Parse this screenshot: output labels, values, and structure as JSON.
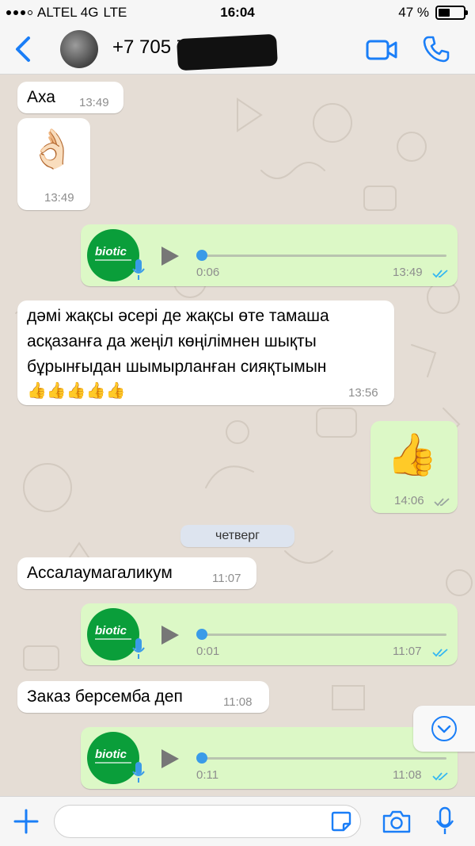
{
  "status_bar": {
    "carrier": "ALTEL 4G",
    "network": "LTE",
    "time": "16:04",
    "battery": "47 %",
    "battery_level": 0.47
  },
  "header": {
    "contact_visible": "+7 705 704 6409",
    "icons": [
      "chevron-left-icon",
      "video-camera-icon",
      "phone-icon"
    ]
  },
  "messages": [
    {
      "kind": "text",
      "direction": "in",
      "text": "Аха",
      "time": "13:49"
    },
    {
      "kind": "emoji",
      "direction": "in",
      "emoji": "👌🏻",
      "time": "13:49"
    },
    {
      "kind": "voice",
      "direction": "out",
      "duration": "0:06",
      "time": "13:49",
      "read": true,
      "thumb_label": "biotic"
    },
    {
      "kind": "text",
      "direction": "in",
      "lines": [
        "дәмі жақсы әсері де жақсы өте тамаша",
        "асқазанға да жеңіл көңілімнен шықты",
        "бұрынғыдан шымырланған сияқтымын",
        "👍👍👍👍👍"
      ],
      "time": "13:56"
    },
    {
      "kind": "emoji",
      "direction": "out",
      "emoji": "👍",
      "time": "14:06",
      "read": false
    },
    {
      "kind": "day",
      "text": "четверг"
    },
    {
      "kind": "text",
      "direction": "in",
      "text": "Ассалаумагаликум",
      "time": "11:07"
    },
    {
      "kind": "voice",
      "direction": "out",
      "duration": "0:01",
      "time": "11:07",
      "read": true,
      "thumb_label": "biotic"
    },
    {
      "kind": "text",
      "direction": "in",
      "text": "Заказ берсемба деп",
      "time": "11:08"
    },
    {
      "kind": "voice",
      "direction": "out",
      "duration": "0:11",
      "time": "11:08",
      "read": true,
      "thumb_label": "biotic"
    }
  ],
  "input_bar": {
    "placeholder": "",
    "icons": [
      "plus-icon",
      "sticker-icon",
      "camera-icon",
      "microphone-icon"
    ]
  },
  "colors": {
    "accent": "#1a7ef7",
    "incoming_bubble": "#ffffff",
    "outgoing_bubble": "#dcf8c6",
    "chat_background": "#e5ddd5",
    "read_ticks": "#34b7f1"
  }
}
